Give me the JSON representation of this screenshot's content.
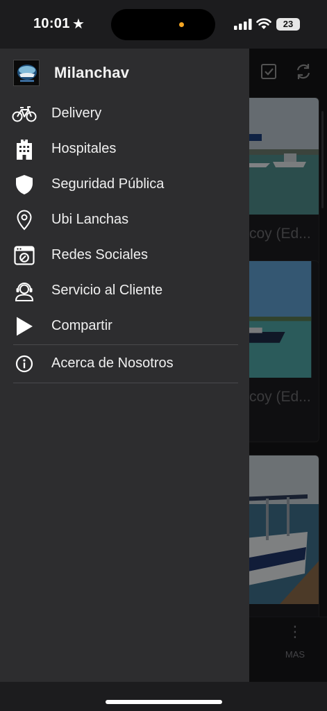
{
  "status_bar": {
    "time": "10:01",
    "time_icon": "star-icon",
    "battery_level": "23"
  },
  "drawer": {
    "app_name": "Milanchav",
    "menu": [
      {
        "icon": "bike-icon",
        "label": "Delivery"
      },
      {
        "icon": "hospital-icon",
        "label": "Hospitales"
      },
      {
        "icon": "shield-icon",
        "label": "Seguridad Pública"
      },
      {
        "icon": "location-pin-icon",
        "label": "Ubi Lanchas"
      },
      {
        "icon": "camera-icon",
        "label": "Redes Sociales"
      },
      {
        "icon": "support-agent-icon",
        "label": "Servicio al Cliente"
      },
      {
        "icon": "play-icon",
        "label": "Compartir"
      }
    ],
    "about": {
      "icon": "info-icon",
      "label": "Acerca de Nosotros"
    }
  },
  "background": {
    "cards": [
      {
        "caption": "coy (Ed..."
      },
      {
        "caption": "coy (Ed..."
      },
      {
        "caption": ""
      }
    ],
    "tab_more_label": "MAS"
  },
  "colors": {
    "drawer_bg": "#2d2d2f",
    "text": "#f0f0f0",
    "accent_dot": "#f5a623"
  }
}
